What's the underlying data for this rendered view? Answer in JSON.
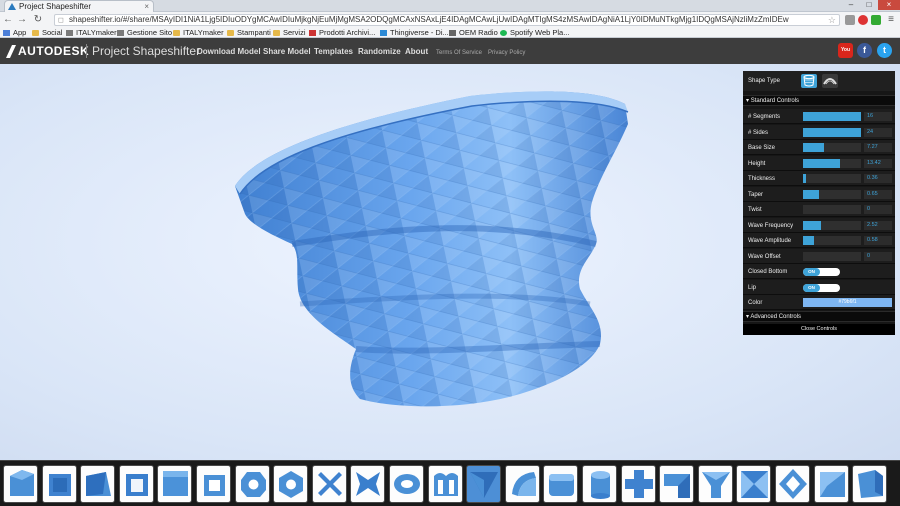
{
  "browser": {
    "tab_title": "Project Shapeshifter",
    "url": "shapeshifter.io/#/share/MSAyIDI1NiA1Ljg5IDIuODYgMCAwIDIuMjkgNjEuMjMgMSA2ODQgMCAxNSAxLjE4IDAgMCAwLjUwIDAgMTIgMS4zMSAwIDAgNiA1LjY0IDMuNTkgMjg1IDQgMSAjNzliMzZmIDEw",
    "bookmarks": [
      {
        "label": "App",
        "icon": "apps-icon"
      },
      {
        "label": "Social",
        "icon": "folder-icon"
      },
      {
        "label": "ITALYmaker",
        "icon": "site-icon"
      },
      {
        "label": "Gestione Sito",
        "icon": "site-icon"
      },
      {
        "label": "ITALYmaker",
        "icon": "folder-icon"
      },
      {
        "label": "Stampanti",
        "icon": "folder-icon"
      },
      {
        "label": "Servizi",
        "icon": "folder-icon"
      },
      {
        "label": "Prodotti Archivi...",
        "icon": "site-icon"
      },
      {
        "label": "Thingiverse - Di...",
        "icon": "site-icon"
      },
      {
        "label": "OEM Radio",
        "icon": "site-icon"
      },
      {
        "label": "Spotify Web Pla...",
        "icon": "site-icon"
      }
    ]
  },
  "nav": {
    "brand": "AUTODESK",
    "product": "Project Shapeshifter",
    "links": [
      "Download Model",
      "Share Model",
      "Templates",
      "Randomize",
      "About"
    ],
    "small_links": [
      "Terms Of Service",
      "Privacy Policy"
    ],
    "social": [
      {
        "icon": "youtube-icon",
        "glyph": "You",
        "color": "#d9261c"
      },
      {
        "icon": "facebook-icon",
        "glyph": "f",
        "color": "#3b5998"
      },
      {
        "icon": "twitter-icon",
        "glyph": "t",
        "color": "#2aa3ef"
      }
    ]
  },
  "panel": {
    "shape_type_label": "Shape Type",
    "standard_controls": "Standard Controls",
    "advanced_controls": "Advanced Controls",
    "close_controls": "Close Controls",
    "sliders": [
      {
        "name": "# Segments",
        "value": "16",
        "level": 1.0
      },
      {
        "name": "# Sides",
        "value": "24",
        "level": 1.0
      },
      {
        "name": "Base Size",
        "value": "7.27",
        "level": 0.36
      },
      {
        "name": "Height",
        "value": "13.42",
        "level": 0.64
      },
      {
        "name": "Thickness",
        "value": "0.36",
        "level": 0.05
      },
      {
        "name": "Taper",
        "value": "0.65",
        "level": 0.28
      },
      {
        "name": "Twist",
        "value": "0",
        "level": 0.0
      },
      {
        "name": "Wave Frequency",
        "value": "2.52",
        "level": 0.31
      },
      {
        "name": "Wave Amplitude",
        "value": "0.58",
        "level": 0.19
      },
      {
        "name": "Wave Offset",
        "value": "0",
        "level": 0.0
      }
    ],
    "toggles": [
      {
        "name": "Closed Bottom",
        "state": "ON"
      },
      {
        "name": "Lip",
        "state": "ON"
      }
    ],
    "color": {
      "name": "Color",
      "value": "#79b6f1",
      "hex": "#7eb6f2"
    }
  },
  "colors": {
    "accent": "#3ea3d8",
    "shape": "#5b9be3",
    "navbar": "#3d3d3d"
  }
}
